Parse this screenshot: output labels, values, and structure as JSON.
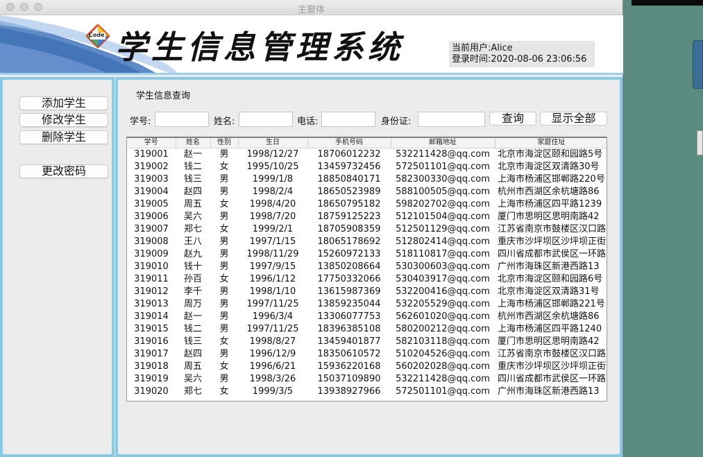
{
  "window": {
    "title": "主窗体"
  },
  "header": {
    "logo_text": "Code",
    "app_title": "学生信息管理系统",
    "current_user": "当前用户:Alice",
    "login_time": "登录时间:2020-08-06 23:06:56"
  },
  "sidebar": {
    "add": "添加学生",
    "edit": "修改学生",
    "delete": "删除学生",
    "change_password": "更改密码"
  },
  "query": {
    "title": "学生信息查询",
    "id_label": "学号:",
    "name_label": "姓名:",
    "phone_label": "电话:",
    "idcard_label": "身份证:",
    "id_value": "",
    "name_value": "",
    "phone_value": "",
    "idcard_value": "",
    "search_button": "查询",
    "show_all_button": "显示全部"
  },
  "table": {
    "columns": [
      "学号",
      "姓名",
      "性别",
      "生日",
      "手机号码",
      "邮箱地址",
      "家庭住址"
    ],
    "rows": [
      [
        "319001",
        "赵一",
        "男",
        "1998/12/27",
        "18706012232",
        "532211428@qq.com",
        "北京市海淀区颐和园路5号"
      ],
      [
        "319002",
        "钱二",
        "女",
        "1995/10/25",
        "13459732456",
        "572501101@qq.com",
        "北京市海淀区双清路30号"
      ],
      [
        "319003",
        "钱三",
        "男",
        "1999/1/8",
        "18850840171",
        "582300330@qq.com",
        "上海市杨浦区邯郸路220号"
      ],
      [
        "319004",
        "赵四",
        "男",
        "1998/2/4",
        "18650523989",
        "588100505@qq.com",
        "杭州市西湖区余杭塘路86"
      ],
      [
        "319005",
        "周五",
        "女",
        "1998/4/20",
        "18650795182",
        "598202702@qq.com",
        "上海市杨浦区四平路1239"
      ],
      [
        "319006",
        "吴六",
        "男",
        "1998/7/20",
        "18759125223",
        "512101504@qq.com",
        "厦门市思明区思明南路42"
      ],
      [
        "319007",
        "郑七",
        "女",
        "1999/2/1",
        "18705908359",
        "512501129@qq.com",
        "江苏省南京市鼓楼区汉口路"
      ],
      [
        "319008",
        "王八",
        "男",
        "1997/1/15",
        "18065178692",
        "512802414@qq.com",
        "重庆市沙坪坝区沙坪坝正街"
      ],
      [
        "319009",
        "赵九",
        "男",
        "1998/11/29",
        "15260972133",
        "518110817@qq.com",
        "四川省成都市武侯区一环路"
      ],
      [
        "319010",
        "钱十",
        "男",
        "1997/9/15",
        "13850208664",
        "530300603@qq.com",
        "广州市海珠区新港西路13"
      ],
      [
        "319011",
        "孙百",
        "女",
        "1996/1/12",
        "17750332066",
        "530403917@qq.com",
        "北京市海淀区颐和园路6号"
      ],
      [
        "319012",
        "李千",
        "男",
        "1998/1/10",
        "13615987369",
        "532200416@qq.com",
        "北京市海淀区双清路31号"
      ],
      [
        "319013",
        "周万",
        "男",
        "1997/11/25",
        "13859235044",
        "532205529@qq.com",
        "上海市杨浦区邯郸路221号"
      ],
      [
        "319014",
        "赵一",
        "男",
        "1996/3/4",
        "13306077753",
        "562601020@qq.com",
        "杭州市西湖区余杭塘路86"
      ],
      [
        "319015",
        "钱二",
        "男",
        "1997/11/25",
        "18396385108",
        "580200212@qq.com",
        "上海市杨浦区四平路1240"
      ],
      [
        "319016",
        "钱三",
        "女",
        "1998/8/27",
        "13459401877",
        "582103118@qq.com",
        "厦门市思明区思明南路42"
      ],
      [
        "319017",
        "赵四",
        "男",
        "1996/12/9",
        "18350610572",
        "510204526@qq.com",
        "江苏省南京市鼓楼区汉口路"
      ],
      [
        "319018",
        "周五",
        "女",
        "1996/6/21",
        "15936220168",
        "560202028@qq.com",
        "重庆市沙坪坝区沙坪坝正街"
      ],
      [
        "319019",
        "吴六",
        "男",
        "1998/3/26",
        "15037109890",
        "532211428@qq.com",
        "四川省成都市武侯区一环路"
      ],
      [
        "319020",
        "郑七",
        "女",
        "1999/3/5",
        "13938927966",
        "572501101@qq.com",
        "广州市海珠区新港西路13"
      ]
    ]
  }
}
